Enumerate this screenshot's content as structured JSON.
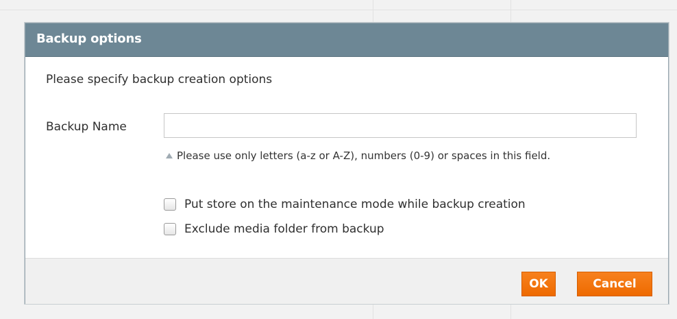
{
  "dialog": {
    "title": "Backup options",
    "intro": "Please specify backup creation options",
    "backup_name": {
      "label": "Backup Name",
      "value": "",
      "hint": "Please use only letters (a-z or A-Z), numbers (0-9) or spaces in this field."
    },
    "options": [
      {
        "label": "Put store on the maintenance mode while backup creation",
        "checked": false
      },
      {
        "label": "Exclude media folder from backup",
        "checked": false
      }
    ],
    "buttons": {
      "ok_label": "OK",
      "cancel_label": "Cancel"
    }
  },
  "colors": {
    "header": "#6d8795",
    "button": "#ef6e00",
    "footer": "#f0f0f0"
  },
  "icons": {
    "hint": "triangle-up-icon"
  }
}
